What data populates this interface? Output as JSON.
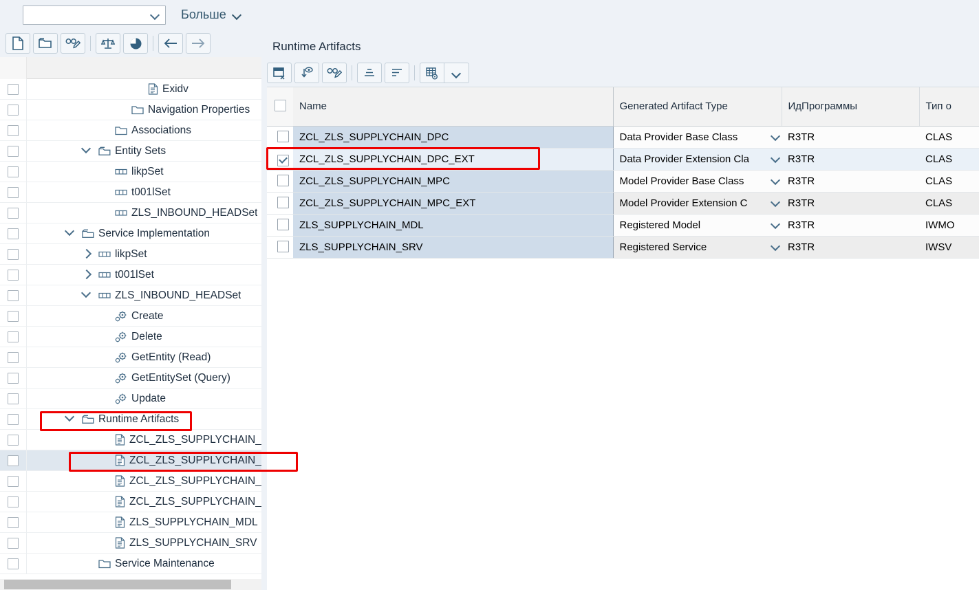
{
  "topbar": {
    "variant_value": "",
    "variant_placeholder": "",
    "more_label": "Больше"
  },
  "left_toolbar": {
    "buttons": [
      {
        "name": "new-icon",
        "title": "Создать"
      },
      {
        "name": "open-folder-icon",
        "title": "Открыть"
      },
      {
        "name": "edit-glasses-icon",
        "title": "Изменить/Отобразить"
      },
      {
        "name": "check-balance-icon",
        "title": "Проверить"
      },
      {
        "name": "pie-chart-icon",
        "title": "Статистика"
      },
      {
        "name": "back-arrow-icon",
        "title": "Назад"
      },
      {
        "name": "forward-arrow-icon",
        "title": "Вперёд"
      }
    ]
  },
  "tree": {
    "items": [
      {
        "label": "Exidv",
        "indent": 6,
        "icon": "document-icon",
        "twisty": "none",
        "selected": false
      },
      {
        "label": "Navigation Properties",
        "indent": 5,
        "icon": "folder-icon",
        "twisty": "none",
        "selected": false
      },
      {
        "label": "Associations",
        "indent": 4,
        "icon": "folder-icon",
        "twisty": "none",
        "selected": false
      },
      {
        "label": "Entity Sets",
        "indent": 3,
        "icon": "folder-open-icon",
        "twisty": "open",
        "selected": false
      },
      {
        "label": "likpSet",
        "indent": 4,
        "icon": "entityset-icon",
        "twisty": "none",
        "selected": false
      },
      {
        "label": "t001lSet",
        "indent": 4,
        "icon": "entityset-icon",
        "twisty": "none",
        "selected": false
      },
      {
        "label": "ZLS_INBOUND_HEADSet",
        "indent": 4,
        "icon": "entityset-icon",
        "twisty": "none",
        "selected": false
      },
      {
        "label": "Service Implementation",
        "indent": 2,
        "icon": "folder-open-icon",
        "twisty": "open",
        "selected": false
      },
      {
        "label": "likpSet",
        "indent": 3,
        "icon": "entityset-icon",
        "twisty": "closed",
        "selected": false
      },
      {
        "label": "t001lSet",
        "indent": 3,
        "icon": "entityset-icon",
        "twisty": "closed",
        "selected": false
      },
      {
        "label": "ZLS_INBOUND_HEADSet",
        "indent": 3,
        "icon": "entityset-icon",
        "twisty": "open",
        "selected": false
      },
      {
        "label": "Create",
        "indent": 4,
        "icon": "gear-icon",
        "twisty": "none",
        "selected": false
      },
      {
        "label": "Delete",
        "indent": 4,
        "icon": "gear-icon",
        "twisty": "none",
        "selected": false
      },
      {
        "label": "GetEntity (Read)",
        "indent": 4,
        "icon": "gear-icon",
        "twisty": "none",
        "selected": false
      },
      {
        "label": "GetEntitySet (Query)",
        "indent": 4,
        "icon": "gear-icon",
        "twisty": "none",
        "selected": false
      },
      {
        "label": "Update",
        "indent": 4,
        "icon": "gear-icon",
        "twisty": "none",
        "selected": false
      },
      {
        "label": "Runtime Artifacts",
        "indent": 2,
        "icon": "folder-open-icon",
        "twisty": "open",
        "selected": false
      },
      {
        "label": "ZCL_ZLS_SUPPLYCHAIN_DPC",
        "indent": 4,
        "icon": "document-icon",
        "twisty": "none",
        "selected": false
      },
      {
        "label": "ZCL_ZLS_SUPPLYCHAIN_DPC_EXT",
        "indent": 4,
        "icon": "document-icon",
        "twisty": "none",
        "selected": true
      },
      {
        "label": "ZCL_ZLS_SUPPLYCHAIN_MPC",
        "indent": 4,
        "icon": "document-icon",
        "twisty": "none",
        "selected": false
      },
      {
        "label": "ZCL_ZLS_SUPPLYCHAIN_MPC_EXT",
        "indent": 4,
        "icon": "document-icon",
        "twisty": "none",
        "selected": false
      },
      {
        "label": "ZLS_SUPPLYCHAIN_MDL",
        "indent": 4,
        "icon": "document-icon",
        "twisty": "none",
        "selected": false
      },
      {
        "label": "ZLS_SUPPLYCHAIN_SRV",
        "indent": 4,
        "icon": "document-icon",
        "twisty": "none",
        "selected": false
      },
      {
        "label": "Service Maintenance",
        "indent": 3,
        "icon": "folder-icon",
        "twisty": "none",
        "selected": false
      }
    ]
  },
  "right": {
    "title": "Runtime Artifacts",
    "toolbar_buttons": [
      {
        "name": "delete-row-icon",
        "title": "Удалить строку"
      },
      {
        "name": "download-eye-icon",
        "title": "Отобразить"
      },
      {
        "name": "edit-glasses-icon",
        "title": "Изменить"
      },
      {
        "name": "sort-ascending-icon",
        "title": "Сортировать по возрастанию"
      },
      {
        "name": "filter-icon",
        "title": "Фильтр"
      },
      {
        "name": "table-settings-icon",
        "title": "Настройки таблицы"
      },
      {
        "name": "chevron-down-icon",
        "title": "Дополнительно"
      }
    ]
  },
  "table": {
    "columns": [
      "Name",
      "Generated Artifact Type",
      "ИдПрограммы",
      "Тип о"
    ],
    "rows": [
      {
        "checked": false,
        "name": "ZCL_ZLS_SUPPLYCHAIN_DPC",
        "artifact_type": "Data Provider Base Class",
        "program_id": "R3TR",
        "object_type": "CLAS"
      },
      {
        "checked": true,
        "name": "ZCL_ZLS_SUPPLYCHAIN_DPC_EXT",
        "artifact_type": "Data Provider Extension Cla",
        "program_id": "R3TR",
        "object_type": "CLAS"
      },
      {
        "checked": false,
        "name": "ZCL_ZLS_SUPPLYCHAIN_MPC",
        "artifact_type": "Model Provider Base Class",
        "program_id": "R3TR",
        "object_type": "CLAS"
      },
      {
        "checked": false,
        "name": "ZCL_ZLS_SUPPLYCHAIN_MPC_EXT",
        "artifact_type": "Model Provider Extension C",
        "program_id": "R3TR",
        "object_type": "CLAS"
      },
      {
        "checked": false,
        "name": "ZLS_SUPPLYCHAIN_MDL",
        "artifact_type": "Registered Model",
        "program_id": "R3TR",
        "object_type": "IWMO"
      },
      {
        "checked": false,
        "name": "ZLS_SUPPLYCHAIN_SRV",
        "artifact_type": "Registered Service",
        "program_id": "R3TR",
        "object_type": "IWSV"
      }
    ]
  },
  "annotations": {
    "highlight_color": "#ee0000",
    "boxes": [
      "grid-row-dpc-ext",
      "tree-runtime-artifacts",
      "tree-item-dpc-ext"
    ]
  }
}
